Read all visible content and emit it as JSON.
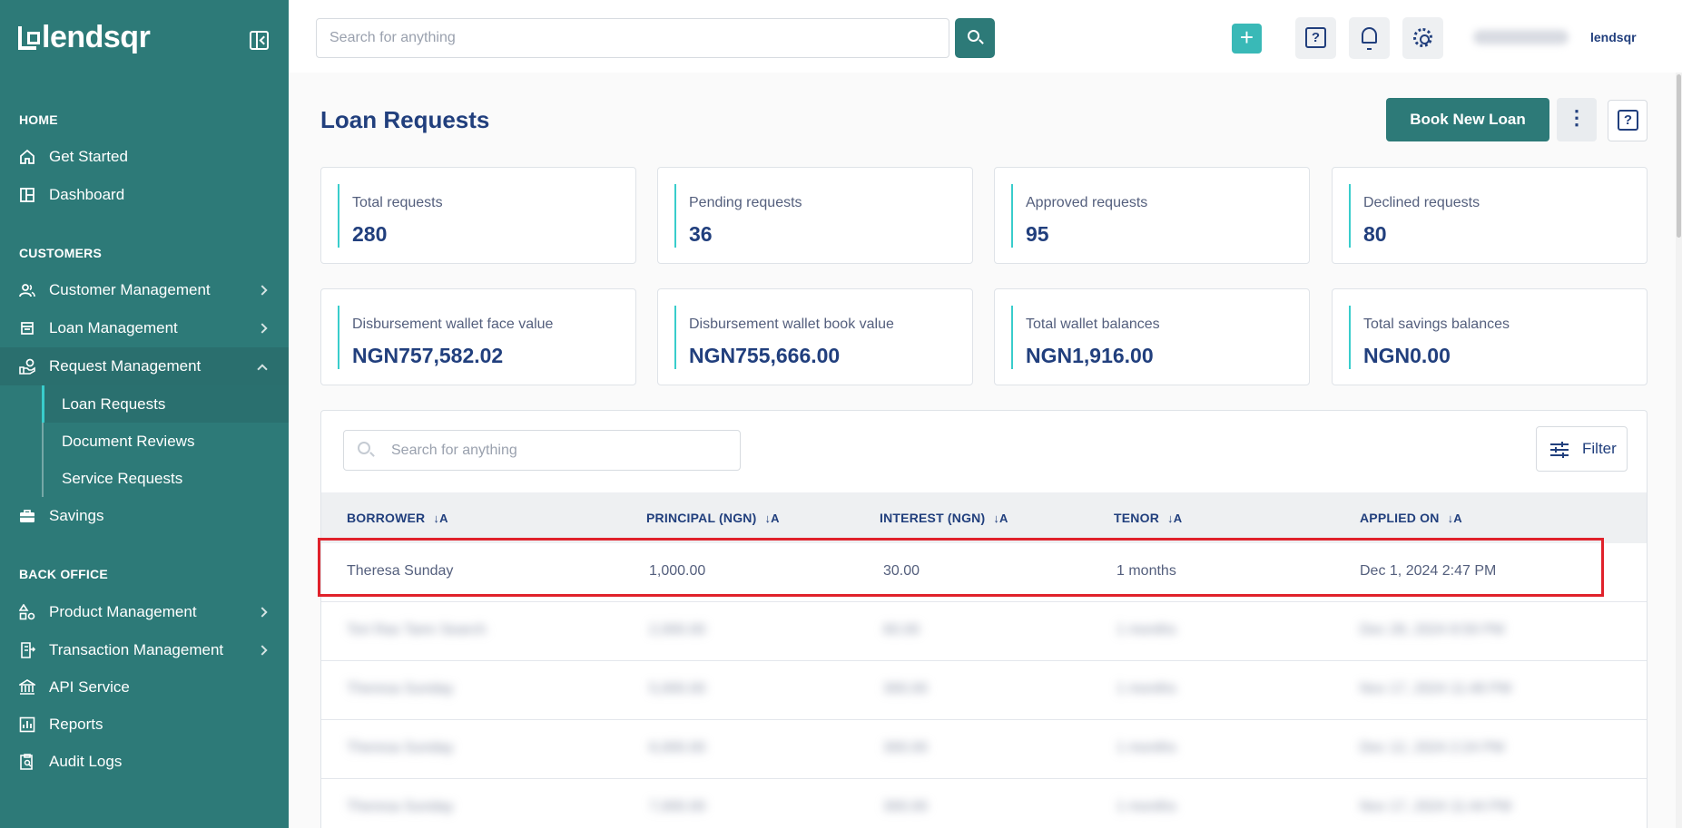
{
  "app": {
    "brand": "lendsqr",
    "brand_small": "lendsqr"
  },
  "search": {
    "placeholder": "Search for anything"
  },
  "sidebar": {
    "sections": [
      {
        "title": "HOME"
      },
      {
        "title": "CUSTOMERS"
      },
      {
        "title": "BACK OFFICE"
      }
    ],
    "items": {
      "get_started": "Get Started",
      "dashboard": "Dashboard",
      "customer_management": "Customer Management",
      "loan_management": "Loan Management",
      "request_management": "Request Management",
      "loan_requests": "Loan Requests",
      "document_reviews": "Document Reviews",
      "service_requests": "Service Requests",
      "savings": "Savings",
      "product_management": "Product Management",
      "transaction_management": "Transaction Management",
      "api_service": "API Service",
      "reports": "Reports",
      "audit_logs": "Audit Logs"
    }
  },
  "header": {
    "plus": "+",
    "help": "?"
  },
  "page": {
    "title": "Loan Requests",
    "book_label": "Book New Loan",
    "more": "⋮"
  },
  "stats": [
    {
      "label": "Total requests",
      "value": "280"
    },
    {
      "label": "Pending requests",
      "value": "36"
    },
    {
      "label": "Approved requests",
      "value": "95"
    },
    {
      "label": "Declined requests",
      "value": "80"
    },
    {
      "label": "Disbursement wallet face value",
      "value": "NGN757,582.02"
    },
    {
      "label": "Disbursement wallet book value",
      "value": "NGN755,666.00"
    },
    {
      "label": "Total wallet balances",
      "value": "NGN1,916.00"
    },
    {
      "label": "Total savings balances",
      "value": "NGN0.00"
    }
  ],
  "table": {
    "search_placeholder": "Search for anything",
    "filter_label": "Filter",
    "columns": [
      "BORROWER",
      "PRINCIPAL (NGN)",
      "INTEREST (NGN)",
      "TENOR",
      "APPLIED ON"
    ],
    "sort_glyph": "↓A",
    "rows": [
      {
        "borrower": "Theresa Sunday",
        "principal": "1,000.00",
        "interest": "30.00",
        "tenor": "1 months",
        "applied_on": "Dec 1, 2024 2:47 PM"
      },
      {
        "borrower": "Tori Ras Tamr Search",
        "principal": "2,000.00",
        "interest": "60.00",
        "tenor": "1 months",
        "applied_on": "Dec 28, 2024 8:59 PM"
      },
      {
        "borrower": "Theresa Sunday",
        "principal": "5,000.00",
        "interest": "300.00",
        "tenor": "1 months",
        "applied_on": "Nov 17, 2024 11:48 PM"
      },
      {
        "borrower": "Theresa Sunday",
        "principal": "6,000.00",
        "interest": "300.00",
        "tenor": "1 months",
        "applied_on": "Dec 12, 2024 2:24 PM"
      },
      {
        "borrower": "Theresa Sunday",
        "principal": "7,000.00",
        "interest": "300.00",
        "tenor": "1 months",
        "applied_on": "Nov 17, 2024 11:44 PM"
      }
    ]
  },
  "colors": {
    "sidebar": "#2d7a78",
    "accent": "#39cdcc",
    "primary_text": "#213f7d",
    "highlight": "#e0222b"
  }
}
